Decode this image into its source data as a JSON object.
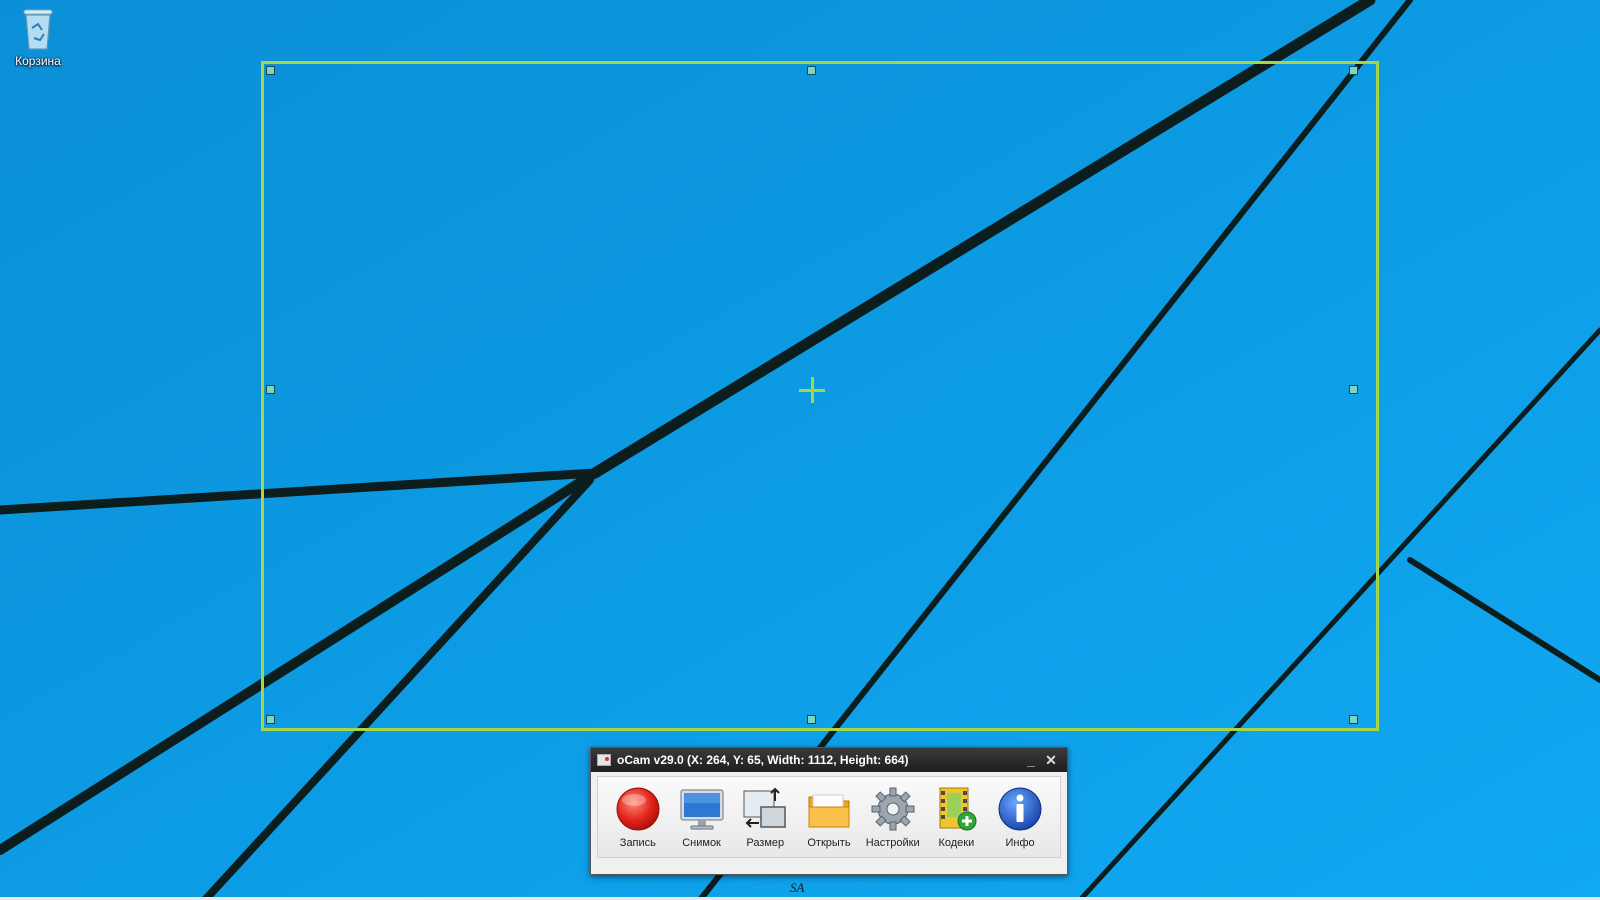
{
  "desktop": {
    "recycle_bin_label": "Корзина",
    "bottom_mark": "SA"
  },
  "ocam": {
    "title": "oCam v29.0 (X: 264, Y: 65, Width: 1112, Height: 664)",
    "minimize": "_",
    "close": "✕",
    "buttons": [
      {
        "label": "Запись"
      },
      {
        "label": "Снимок"
      },
      {
        "label": "Размер"
      },
      {
        "label": "Открыть"
      },
      {
        "label": "Настройки"
      },
      {
        "label": "Кодеки"
      },
      {
        "label": "Инфо"
      }
    ]
  },
  "colors": {
    "selection_border": "#a5d64a",
    "desktop_blue": "#0a9ee8"
  }
}
